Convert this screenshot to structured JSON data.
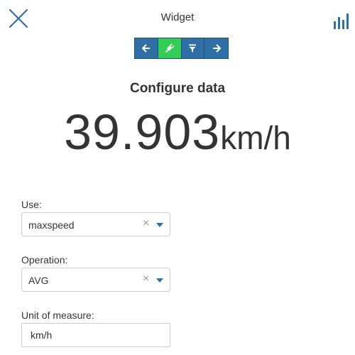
{
  "header": {
    "title": "Widget",
    "close_icon": "close-icon",
    "chart_icon": "bar-chart-icon"
  },
  "stepper": {
    "steps": [
      {
        "icon": "arrow-left-icon",
        "active": false
      },
      {
        "icon": "plug-icon",
        "active": true
      },
      {
        "icon": "filter-icon",
        "active": false
      },
      {
        "icon": "arrow-right-icon",
        "active": false
      }
    ]
  },
  "main": {
    "section_title": "Configure data",
    "value": "39.903",
    "unit": "km/h"
  },
  "form": {
    "use": {
      "label": "Use:",
      "value": "maxspeed"
    },
    "operation": {
      "label": "Operation:",
      "value": "AVG"
    },
    "unit": {
      "label": "Unit of measure:",
      "value": "km/h"
    }
  },
  "colors": {
    "accent": "#2f6fa6",
    "active": "#33cc55",
    "text": "#333333"
  }
}
